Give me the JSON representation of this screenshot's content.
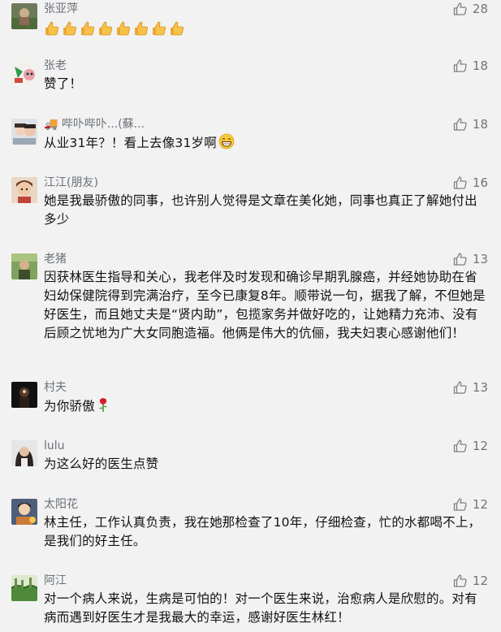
{
  "comments": [
    {
      "name": "张亚萍",
      "likes": "28",
      "text": "",
      "emoji": "thumbs-up-emoji-x8"
    },
    {
      "name": "张老",
      "likes": "18",
      "text": "赞了！"
    },
    {
      "name": "🚚 哔卟哔卟...(蘇...",
      "likes": "18",
      "text": "从业31年？！看上去像31岁啊",
      "emoji": "grinning-face-emoji"
    },
    {
      "name": "江江(朋友)",
      "likes": "16",
      "text": "她是我最骄傲的同事，也许别人觉得是文章在美化她，同事也真正了解她付出多少"
    },
    {
      "name": "老猪",
      "likes": "13",
      "text": "因获林医生指导和关心，我老伴及时发现和确诊早期乳腺癌，并经她协助在省妇幼保健院得到完满治疗，至今已康复8年。顺带说一句，据我了解，不但她是好医生，而且她丈夫是“贤内助”，包揽家务并做好吃的，让她精力充沛、没有后顾之忧地为广大女同胞造福。他俩是伟大的伉俪，我夫妇衷心感谢他们！"
    },
    {
      "name": "村夫",
      "likes": "13",
      "text": "为你骄傲",
      "emoji": "rose-emoji"
    },
    {
      "name": "lulu",
      "likes": "12",
      "text": "为这么好的医生点赞"
    },
    {
      "name": "太阳花",
      "likes": "12",
      "text": "林主任，工作认真负责，我在她那检查了10年，仔细检查，忙的水都喝不上，是我们的好主任。"
    },
    {
      "name": "阿江",
      "likes": "12",
      "text": "对一个病人来说，生病是可怕的！对一个医生来说，治愈病人是欣慰的。对有病而遇到好医生才是我最大的幸运，感谢好医生林红！"
    }
  ]
}
